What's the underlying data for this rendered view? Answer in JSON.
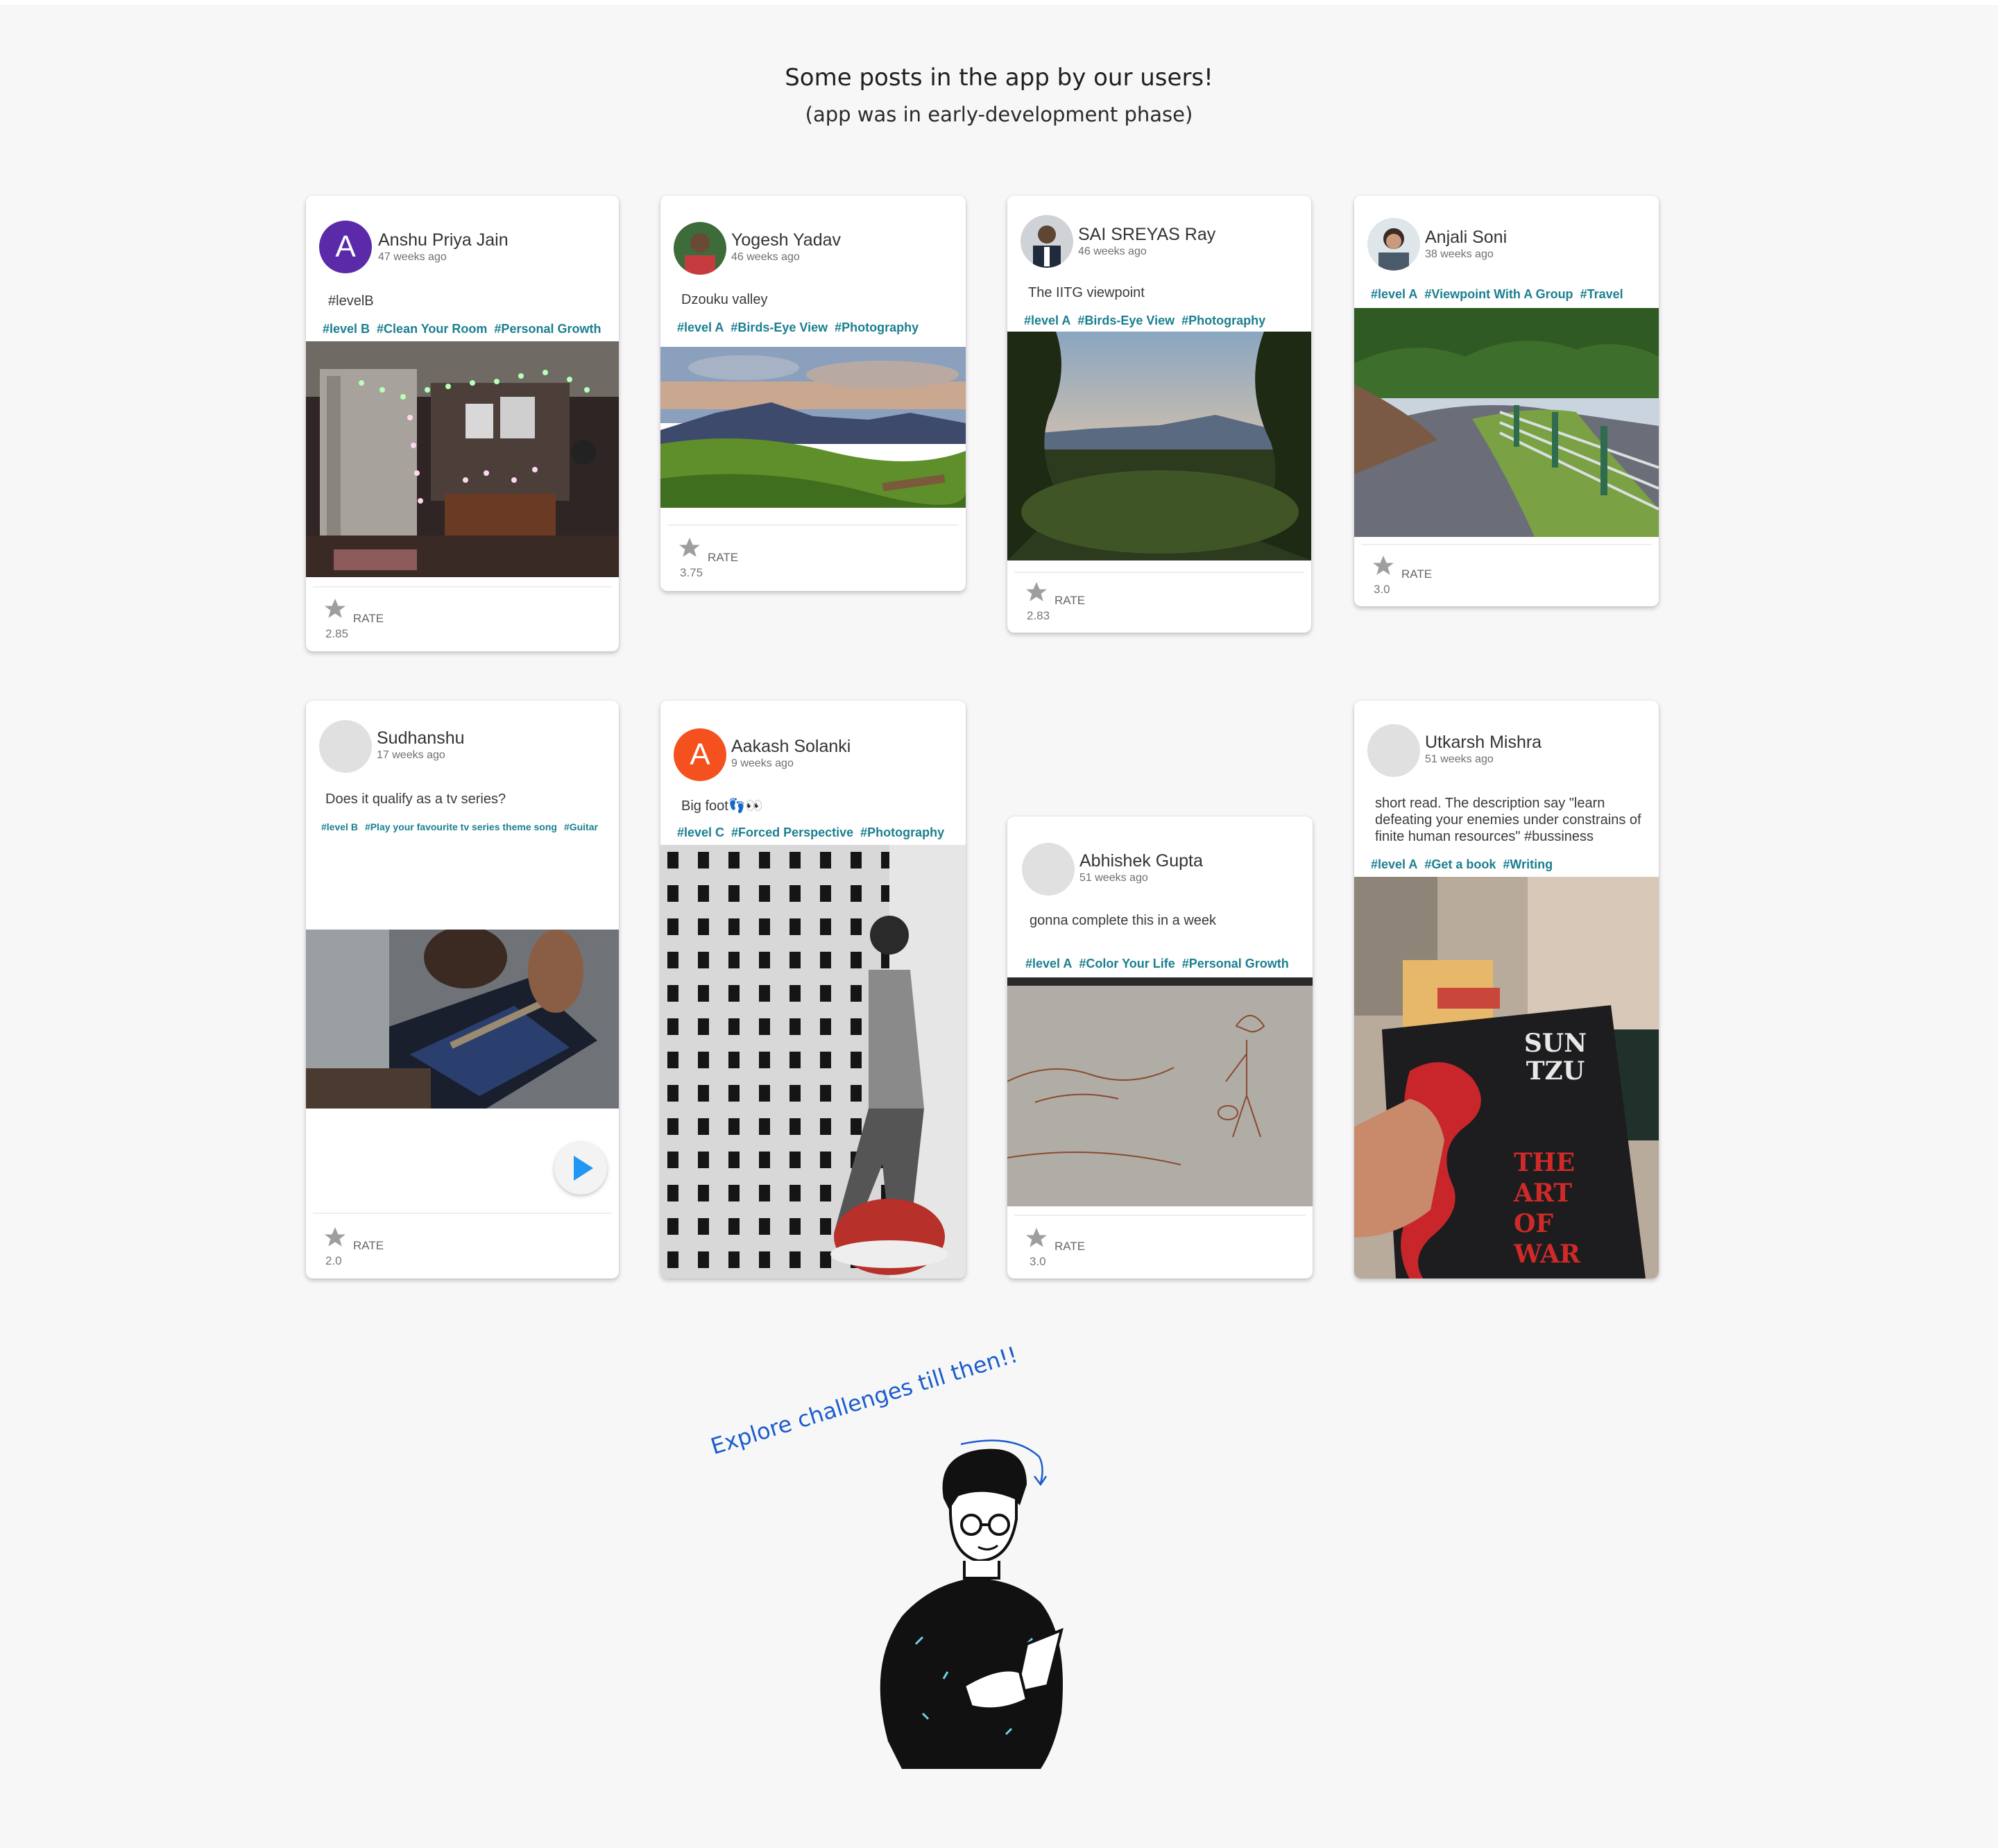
{
  "header": {
    "title": "Some posts in the app by our users!",
    "subtitle": "(app was in early-development phase)"
  },
  "rate_label": "RATE",
  "posts": [
    {
      "user": "Anshu Priya Jain",
      "time": "47 weeks ago",
      "avatar_letter": "A",
      "avatar_color": "#5b2aa8",
      "caption": "#levelB",
      "tags": [
        "#level B",
        "#Clean Your Room",
        "#Personal Growth"
      ],
      "score": "2.85",
      "photo": "fairy-lights-room"
    },
    {
      "user": "Yogesh Yadav",
      "time": "46 weeks ago",
      "caption": "Dzouku valley",
      "tags": [
        "#level A",
        "#Birds-Eye View",
        "#Photography"
      ],
      "score": "3.75",
      "photo": "valley-sunset"
    },
    {
      "user": "SAI SREYAS Ray",
      "time": "46 weeks ago",
      "caption": "The IITG viewpoint",
      "tags": [
        "#level A",
        "#Birds-Eye View",
        "#Photography"
      ],
      "score": "2.83",
      "photo": "hill-viewpoint"
    },
    {
      "user": "Anjali Soni",
      "time": "38 weeks ago",
      "caption": "",
      "tags": [
        "#level A",
        "#Viewpoint With A Group",
        "#Travel"
      ],
      "score": "3.0",
      "photo": "winding-road"
    },
    {
      "user": "Sudhanshu",
      "time": "17 weeks ago",
      "caption": "Does it qualify as a tv series?",
      "tags": [
        "#level B",
        "#Play your favourite tv series theme song",
        "#Guitar"
      ],
      "score": "2.0",
      "photo": "guitar-video"
    },
    {
      "user": "Aakash Solanki",
      "time": "9 weeks ago",
      "avatar_letter": "A",
      "avatar_color": "#f4511e",
      "caption": "Big foot👣👀",
      "tags": [
        "#level C",
        "#Forced Perspective",
        "#Photography"
      ],
      "score": "",
      "photo": "forced-perspective"
    },
    {
      "user": "Abhishek Gupta",
      "time": "51 weeks ago",
      "caption": "gonna complete this in a week",
      "tags": [
        "#level A",
        "#Color Your Life",
        "#Personal Growth"
      ],
      "score": "3.0",
      "photo": "wall-sketch"
    },
    {
      "user": "Utkarsh Mishra",
      "time": "51 weeks ago",
      "caption": "short read. The description say \"learn defeating your enemies under constrains of finite human resources\" #bussiness",
      "tags": [
        "#level A",
        "#Get a book",
        "#Writing"
      ],
      "score": "",
      "photo": "book-art-of-war"
    }
  ],
  "book": {
    "author": "SUN TZU",
    "title_line1": "THE",
    "title_line2": "ART",
    "title_line3": "OF",
    "title_line4": "WAR"
  },
  "footer": {
    "cta": "Explore challenges till then!!",
    "illustration": "person-reading-phone"
  },
  "colors": {
    "tag": "#1b7f90",
    "accent": "#1a5dcc",
    "play": "#2196f3"
  }
}
